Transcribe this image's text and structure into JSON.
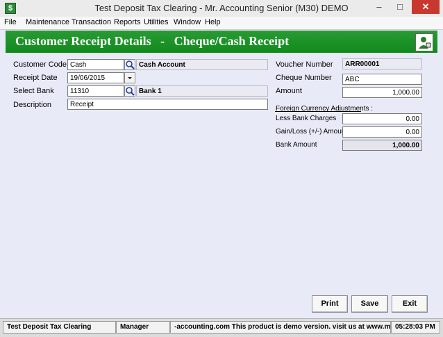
{
  "window": {
    "title": "Test Deposit Tax Clearing - Mr. Accounting Senior (M30) DEMO",
    "min": "–",
    "max": "□",
    "close": "✕"
  },
  "menu": [
    "File",
    "Maintenance",
    "Transaction",
    "Reports",
    "Utilities",
    "Window",
    "Help"
  ],
  "header": {
    "title": "Customer Receipt Details   -   Cheque/Cash Receipt"
  },
  "form": {
    "customer_code": {
      "label": "Customer Code",
      "value": "Cash",
      "name": "Cash Account"
    },
    "receipt_date": {
      "label": "Receipt Date",
      "value": "19/06/2015"
    },
    "select_bank": {
      "label": "Select Bank",
      "value": "11310",
      "name": "Bank 1"
    },
    "description": {
      "label": "Description",
      "value": "Receipt"
    },
    "voucher_number": {
      "label": "Voucher Number",
      "value": "ARR00001"
    },
    "cheque_number": {
      "label": "Cheque Number",
      "value": "ABC"
    },
    "amount": {
      "label": "Amount",
      "value": "1,000.00"
    },
    "fx_heading": "Foreign Currency Adjustments :",
    "less_bank_charges": {
      "label": "Less Bank Charges",
      "value": "0.00"
    },
    "gain_loss": {
      "label": "Gain/Loss (+/-) Amount",
      "value": "0.00"
    },
    "bank_amount": {
      "label": "Bank Amount",
      "value": "1,000.00"
    }
  },
  "buttons": {
    "print": "Print",
    "save": "Save",
    "exit": "Exit"
  },
  "status": {
    "company": "Test Deposit Tax Clearing",
    "user": "Manager",
    "message": "-accounting.com This product is demo version.  visit us at www.mr",
    "time": "05:28:03 PM"
  },
  "icons": {
    "lookup": "search-icon",
    "dropdown": "chevron-down-icon",
    "header": "person-icon"
  },
  "colors": {
    "header_green": "#1a9126",
    "background": "#e9eaf7",
    "close_red": "#c7382f"
  }
}
